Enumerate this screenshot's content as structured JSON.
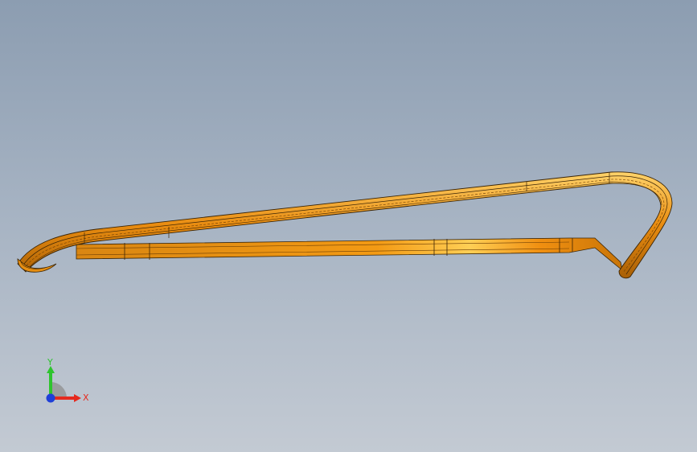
{
  "viewport": {
    "part_color": "#f29a12",
    "edge_color": "#3a2406"
  },
  "triad": {
    "x_label": "X",
    "y_label": "Y",
    "x_color": "#e52a1e",
    "y_color": "#2ec42e",
    "z_color": "#1f3fd8",
    "icon": "coordinate-triad-icon"
  }
}
